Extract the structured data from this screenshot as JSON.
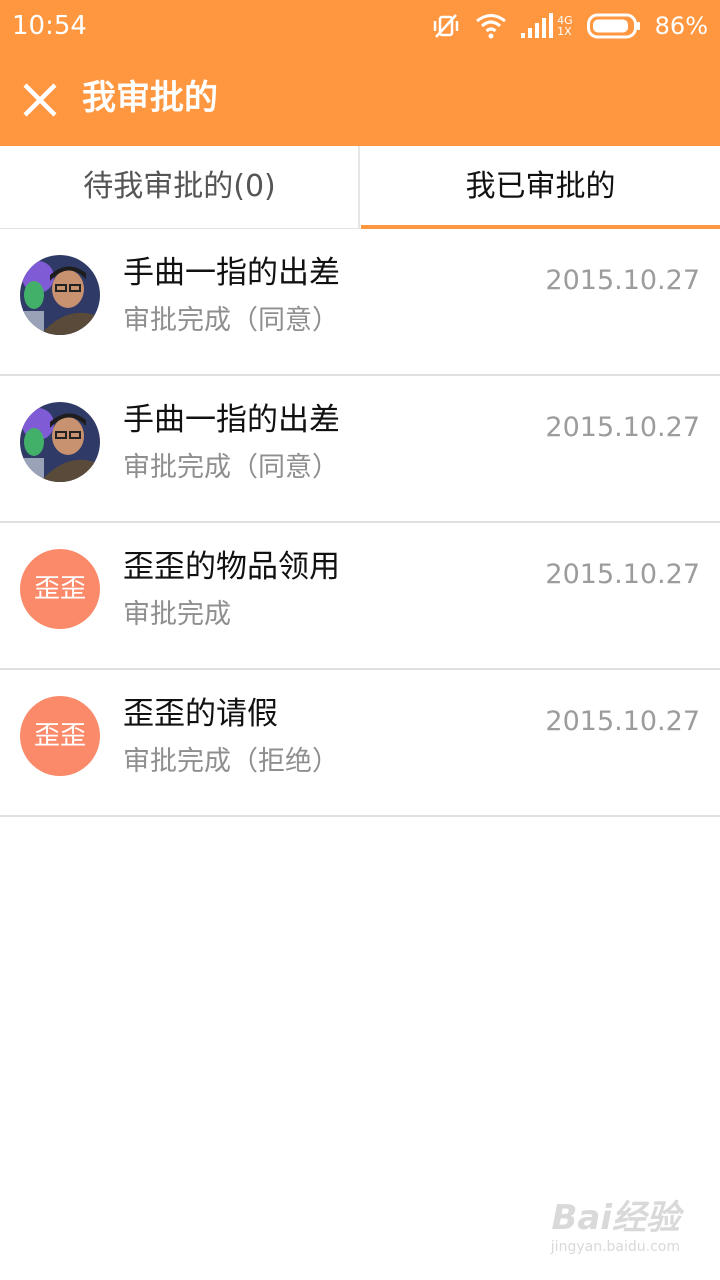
{
  "status_bar": {
    "time": "10:54",
    "network_top": "4G",
    "network_bottom": "1X",
    "battery": "86%",
    "icons": [
      "vibrate-off-icon",
      "wifi-icon",
      "signal-icon",
      "battery-icon"
    ]
  },
  "app_bar": {
    "title": "我审批的",
    "close_icon": "close-icon"
  },
  "tabs": [
    {
      "label": "待我审批的(0)",
      "active": false
    },
    {
      "label": "我已审批的",
      "active": true
    }
  ],
  "items": [
    {
      "avatar": "photo",
      "title": "手曲一指的出差",
      "status": "审批完成（同意）",
      "date": "2015.10.27"
    },
    {
      "avatar": "photo",
      "title": "手曲一指的出差",
      "status": "审批完成（同意）",
      "date": "2015.10.27"
    },
    {
      "avatar_text": "歪歪",
      "title": "歪歪的物品领用",
      "status": "审批完成",
      "date": "2015.10.27"
    },
    {
      "avatar_text": "歪歪",
      "title": "歪歪的请假",
      "status": "审批完成（拒绝）",
      "date": "2015.10.27"
    }
  ],
  "watermark": {
    "logo": "Bai经验",
    "url": "jingyan.baidu.com"
  },
  "colors": {
    "accent": "#ff9640",
    "avatar_bg": "#fb8a6a"
  }
}
